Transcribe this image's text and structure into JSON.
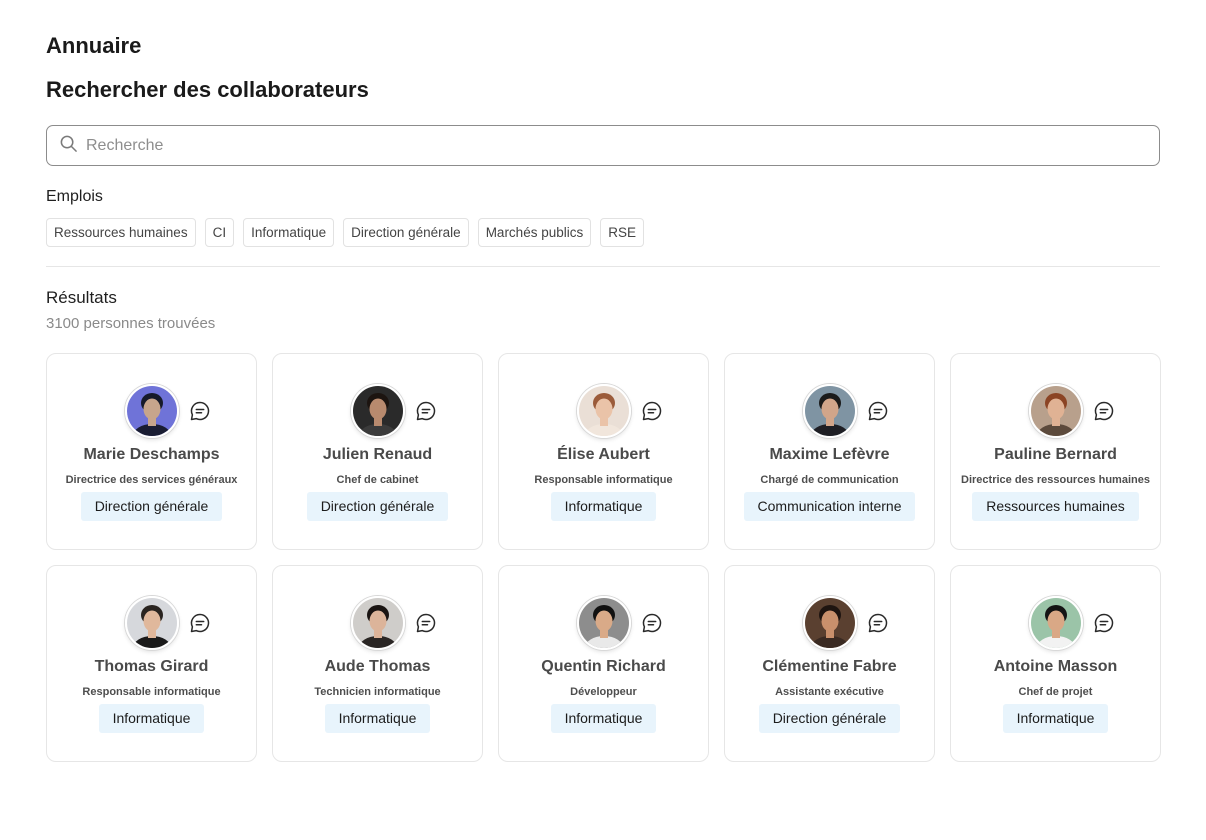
{
  "header": {
    "title": "Annuaire",
    "subtitle": "Rechercher des collaborateurs"
  },
  "search": {
    "placeholder": "Recherche",
    "value": "",
    "icon": "search-icon"
  },
  "filters": {
    "title": "Emplois",
    "chips": [
      "Ressources humaines",
      "CI",
      "Informatique",
      "Direction générale",
      "Marchés publics",
      "RSE"
    ]
  },
  "results": {
    "title": "Résultats",
    "count": "3100 personnes trouvées",
    "people": [
      {
        "name": "Marie Deschamps",
        "role": "Directrice des services généraux",
        "dept": "Direction générale",
        "avatar": {
          "bg": "#6f73d8",
          "skin": "#c7a58c",
          "hair": "#161a2a",
          "shirt": "#1a1d33"
        }
      },
      {
        "name": "Julien Renaud",
        "role": "Chef de cabinet",
        "dept": "Direction générale",
        "avatar": {
          "bg": "#2a2a2a",
          "skin": "#b88a6e",
          "hair": "#1c1410",
          "shirt": "#3b3b3b"
        }
      },
      {
        "name": "Élise Aubert",
        "role": "Responsable informatique",
        "dept": "Informatique",
        "avatar": {
          "bg": "#eadfd6",
          "skin": "#eac3a8",
          "hair": "#9b5b3a",
          "shirt": "#f1e6dc"
        }
      },
      {
        "name": "Maxime Lefèvre",
        "role": "Chargé de communication",
        "dept": "Communication interne",
        "avatar": {
          "bg": "#7f94a3",
          "skin": "#d1a58a",
          "hair": "#1a1a1a",
          "shirt": "#1e1e24"
        }
      },
      {
        "name": "Pauline Bernard",
        "role": "Directrice des ressources humaines",
        "dept": "Ressources humaines",
        "avatar": {
          "bg": "#b8a08c",
          "skin": "#e0b294",
          "hair": "#8b4424",
          "shirt": "#5c4a3c"
        }
      },
      {
        "name": "Thomas Girard",
        "role": "Responsable informatique",
        "dept": "Informatique",
        "avatar": {
          "bg": "#d6d8dc",
          "skin": "#e0b89c",
          "hair": "#2a2420",
          "shirt": "#1a1a1a"
        }
      },
      {
        "name": "Aude Thomas",
        "role": "Technicien informatique",
        "dept": "Informatique",
        "avatar": {
          "bg": "#cfcdca",
          "skin": "#dcb49a",
          "hair": "#1a1412",
          "shirt": "#2a2624"
        }
      },
      {
        "name": "Quentin Richard",
        "role": "Développeur",
        "dept": "Informatique",
        "avatar": {
          "bg": "#8d8d8d",
          "skin": "#d9aa88",
          "hair": "#111111",
          "shirt": "#e9e9e9"
        }
      },
      {
        "name": "Clémentine Fabre",
        "role": "Assistante exécutive",
        "dept": "Direction générale",
        "avatar": {
          "bg": "#5a4030",
          "skin": "#c9906c",
          "hair": "#1e1410",
          "shirt": "#3a2a22"
        }
      },
      {
        "name": "Antoine Masson",
        "role": "Chef de projet",
        "dept": "Informatique",
        "avatar": {
          "bg": "#9bc4a8",
          "skin": "#d9a886",
          "hair": "#141414",
          "shirt": "#f2f2f2"
        }
      }
    ]
  }
}
